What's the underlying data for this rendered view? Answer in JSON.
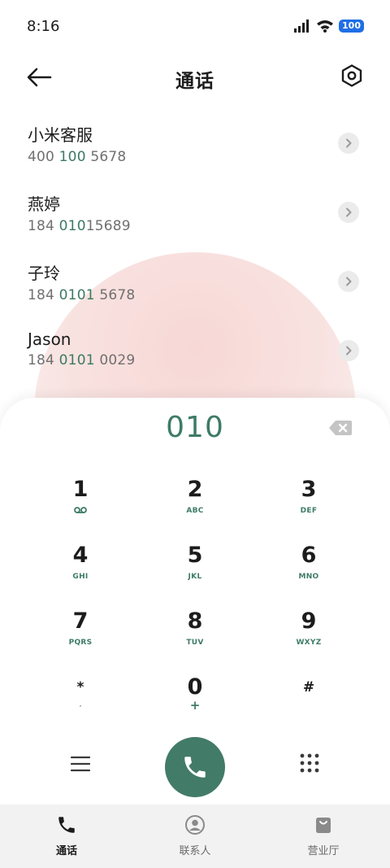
{
  "status": {
    "time": "8:16",
    "battery": "100"
  },
  "header": {
    "title": "通话"
  },
  "contacts": [
    {
      "name": "小米客服",
      "number_pre": "400 ",
      "number_hl": "100",
      "number_post": " 5678"
    },
    {
      "name": "燕婷",
      "number_pre": "184 ",
      "number_hl": "010",
      "number_post": "15689"
    },
    {
      "name": "子玲",
      "number_pre": "184 ",
      "number_hl": "0101",
      "number_post": " 5678"
    },
    {
      "name": "Jason",
      "number_pre": "184 ",
      "number_hl": "0101",
      "number_post": " 0029"
    }
  ],
  "dialpad": {
    "entered_number": "010",
    "keys": [
      {
        "digit": "1",
        "letters": ""
      },
      {
        "digit": "2",
        "letters": "ABC"
      },
      {
        "digit": "3",
        "letters": "DEF"
      },
      {
        "digit": "4",
        "letters": "GHI"
      },
      {
        "digit": "5",
        "letters": "JKL"
      },
      {
        "digit": "6",
        "letters": "MNO"
      },
      {
        "digit": "7",
        "letters": "PQRS"
      },
      {
        "digit": "8",
        "letters": "TUV"
      },
      {
        "digit": "9",
        "letters": "WXYZ"
      },
      {
        "digit": "*",
        "letters": ","
      },
      {
        "digit": "0",
        "letters": "+"
      },
      {
        "digit": "#",
        "letters": ""
      }
    ]
  },
  "bottom_nav": [
    {
      "label": "通话",
      "icon": "phone-icon",
      "active": true
    },
    {
      "label": "联系人",
      "icon": "contacts-icon",
      "active": false
    },
    {
      "label": "营业厅",
      "icon": "store-bag-icon",
      "active": false
    }
  ],
  "colors": {
    "accent": "#427b68",
    "accent_text": "#3d7b65",
    "battery": "#1f6fe5",
    "nav_bg": "#f2f2f2"
  }
}
